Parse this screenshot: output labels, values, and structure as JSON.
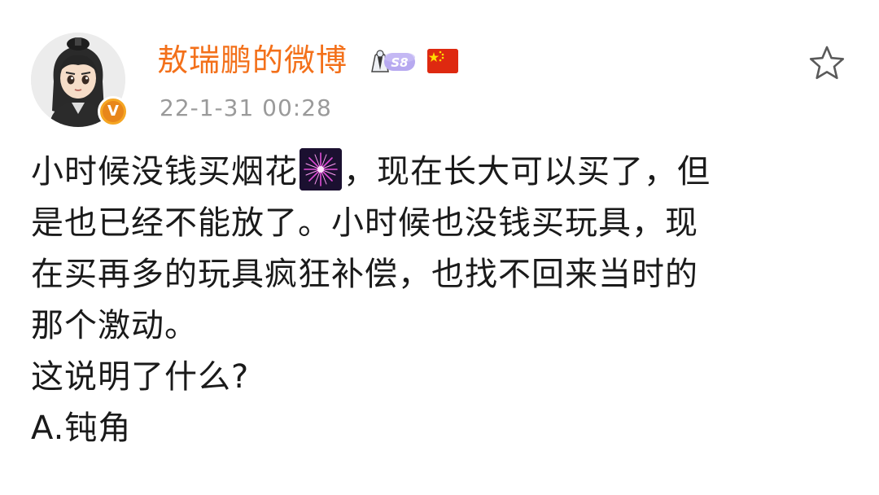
{
  "post": {
    "author": {
      "name": "敖瑞鹏的微博",
      "level_badge": "S8",
      "verified_mark": "V",
      "avatar_icon": "cartoon-avatar",
      "flag_icon": "china-flag-icon"
    },
    "timestamp": "22-1-31 00:28",
    "favorite_icon": "star-outline-icon",
    "body": {
      "line1_before_icon": "小时候没钱买烟花",
      "inline_icon": "firework-icon",
      "line1_after_icon": "，现在长大可以买了，但",
      "line2": "是也已经不能放了。小时候也没钱买玩具，现",
      "line3": "在买再多的玩具疯狂补偿，也找不回来当时的",
      "line4": "那个激动。",
      "line5": "这说明了什么?",
      "line6": "A.钝角"
    }
  },
  "colors": {
    "username": "#f3701a",
    "timestamp": "#9a9a9a",
    "body_text": "#1a1a1a",
    "verified_badge": "#f5a623",
    "flag_red": "#de2910",
    "flag_yellow": "#ffde00"
  }
}
